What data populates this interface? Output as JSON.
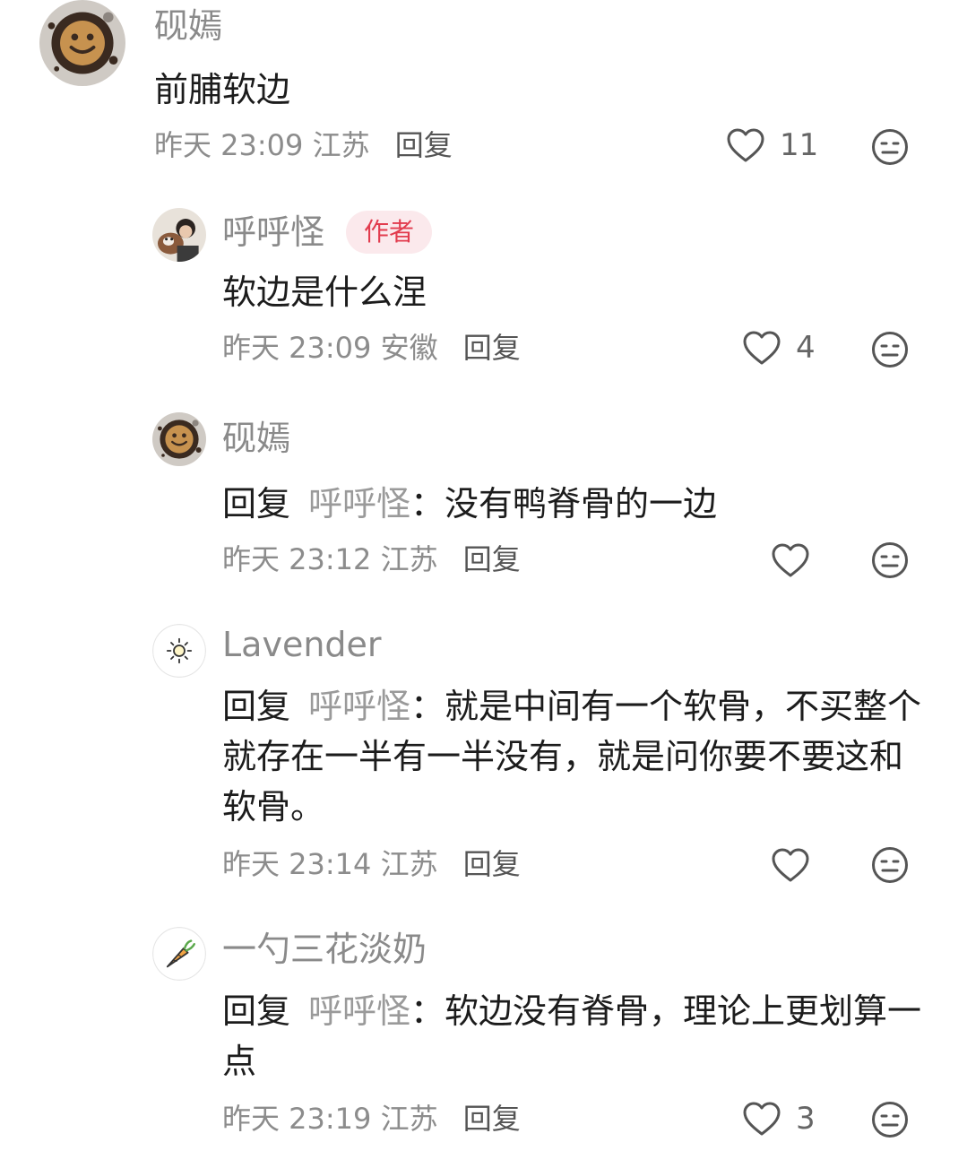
{
  "comments": [
    {
      "name": "砚嫣",
      "text": "前脯软边",
      "time": "昨天 23:09",
      "location": "江苏",
      "reply_label": "回复",
      "likes": "11",
      "avatar": "smiley-latte-icon"
    },
    {
      "name": "呼呼怪",
      "badge": "作者",
      "text": "软边是什么涅",
      "time": "昨天 23:09",
      "location": "安徽",
      "reply_label": "回复",
      "likes": "4",
      "avatar": "person-with-dog-photo"
    },
    {
      "name": "砚嫣",
      "reply_prefix": "回复",
      "mention": "呼呼怪",
      "sep": "：",
      "text": "没有鸭脊骨的一边",
      "time": "昨天 23:12",
      "location": "江苏",
      "reply_label": "回复",
      "likes": "",
      "avatar": "smiley-latte-icon"
    },
    {
      "name": "Lavender",
      "reply_prefix": "回复",
      "mention": "呼呼怪",
      "sep": "：",
      "text": "就是中间有一个软骨，不买整个就存在一半有一半没有，就是问你要不要这和软骨。",
      "time": "昨天 23:14",
      "location": "江苏",
      "reply_label": "回复",
      "likes": "",
      "avatar": "sun-icon"
    },
    {
      "name": "一勺三花淡奶",
      "reply_prefix": "回复",
      "mention": "呼呼怪",
      "sep": "：",
      "text": "软边没有脊骨，理论上更划算一点",
      "time": "昨天 23:19",
      "location": "江苏",
      "reply_label": "回复",
      "likes": "3",
      "avatar": "carrot-icon"
    }
  ],
  "colors": {
    "name": "#8a8a8a",
    "text": "#1c1c1c",
    "meta": "#8c8c8c",
    "badge_bg": "#fbe9ec",
    "badge_text": "#e23c4e"
  }
}
